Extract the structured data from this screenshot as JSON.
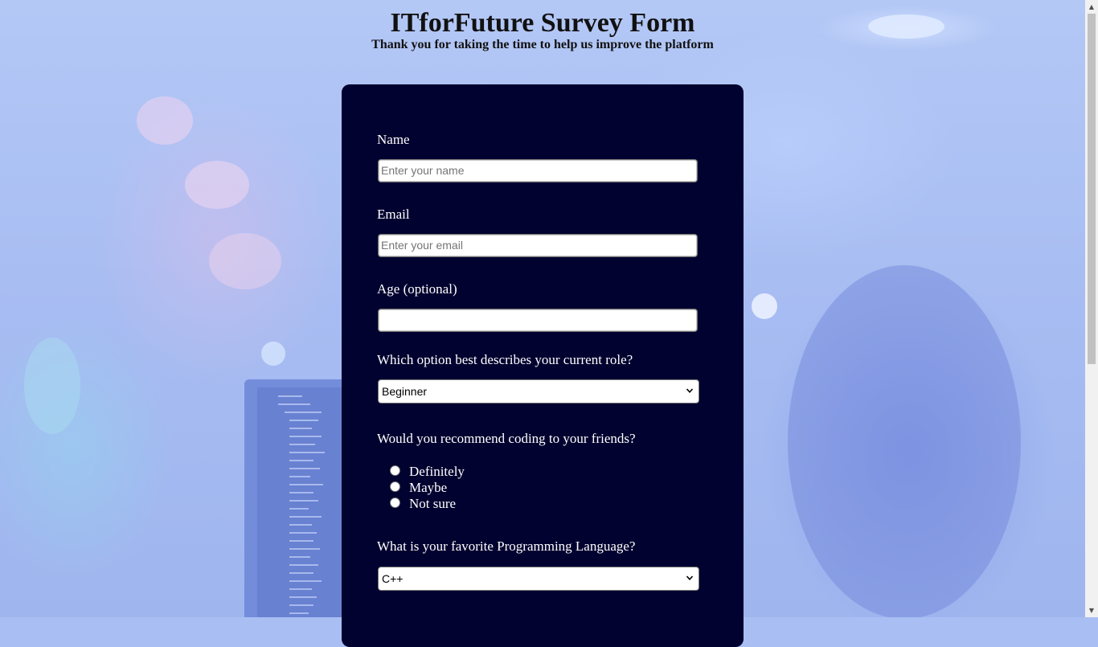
{
  "header": {
    "title": "ITforFuture Survey Form",
    "subtitle": "Thank you for taking the time to help us improve the platform"
  },
  "form": {
    "name": {
      "label": "Name",
      "placeholder": "Enter your name"
    },
    "email": {
      "label": "Email",
      "placeholder": "Enter your email"
    },
    "age": {
      "label": "Age (optional)",
      "placeholder": ""
    },
    "role": {
      "label": "Which option best describes your current role?",
      "selected": "Beginner"
    },
    "recommend": {
      "label": "Would you recommend coding to your friends?",
      "options": [
        "Definitely",
        "Maybe",
        "Not sure"
      ]
    },
    "language": {
      "label": "What is your favorite Programming Language?",
      "selected": "C++"
    }
  },
  "icons": {
    "select_arrow": "chevron-down-icon",
    "scroll_up": "triangle-up-icon",
    "scroll_down": "triangle-down-icon"
  },
  "colors": {
    "form_background": "#020230",
    "page_background": "#a9bff3"
  }
}
